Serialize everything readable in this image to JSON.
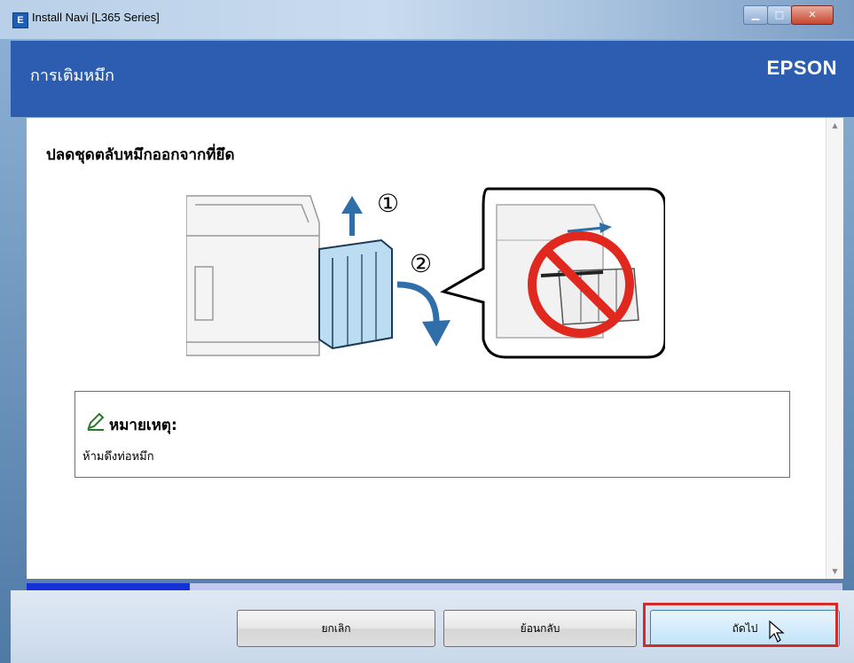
{
  "window": {
    "title": "Install Navi [L365 Series]",
    "icon": "epson-app-icon",
    "icon_glyph": "E",
    "controls": {
      "minimize": "minimize-icon",
      "maximize": "maximize-icon",
      "close": "close-icon"
    }
  },
  "header": {
    "title": "การเติมหมึก",
    "brand": "EPSON"
  },
  "content": {
    "step_heading": "ปลดชุดตลับหมึกออกจากที่ยึด",
    "illustration": {
      "step_markers": [
        "①",
        "②"
      ],
      "icons": [
        "printer-icon",
        "ink-tank-icon",
        "up-arrow-icon",
        "rotate-arrow-icon",
        "prohibited-icon"
      ]
    },
    "note": {
      "title": "หมายเหตุ:",
      "text": "ห้ามดึงท่อหมึก",
      "icon": "pencil-icon"
    }
  },
  "progress": {
    "fraction": 0.2,
    "color": "#1530d6",
    "track_color": "#c5c9f2"
  },
  "buttons": {
    "cancel": "ยกเลิก",
    "back": "ย้อนกลับ",
    "next": "ถัดไป"
  },
  "colors": {
    "header": "#2d5db1",
    "highlight": "#d42a2a",
    "prohibited": "#e0281e"
  }
}
